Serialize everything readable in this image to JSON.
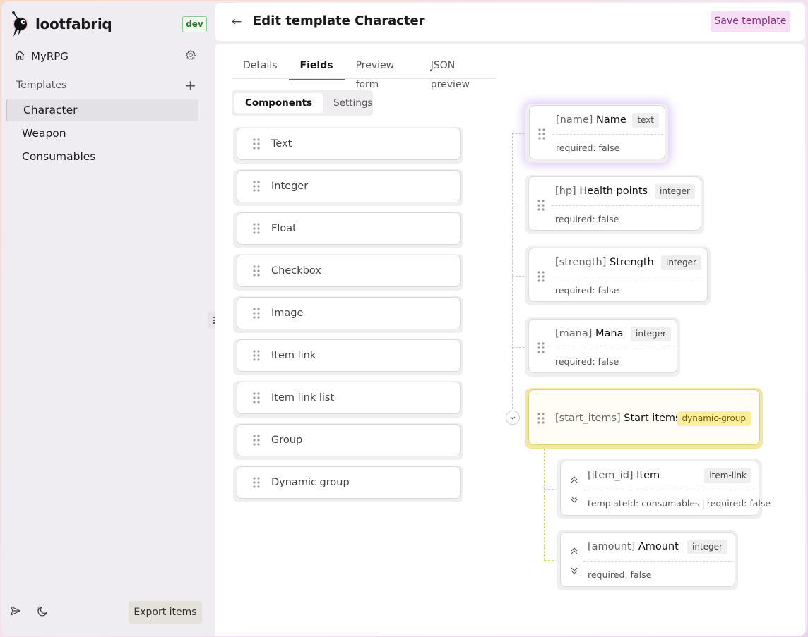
{
  "app": {
    "name": "lootfabriq",
    "env_badge": "dev",
    "project": "MyRPG"
  },
  "sidebar": {
    "section_label": "Templates",
    "items": [
      {
        "label": "Character",
        "active": true
      },
      {
        "label": "Weapon",
        "active": false
      },
      {
        "label": "Consumables",
        "active": false
      }
    ],
    "export_label": "Export items"
  },
  "header": {
    "title": "Edit template Character",
    "save_label": "Save template"
  },
  "tabs": [
    {
      "label": "Details",
      "active": false
    },
    {
      "label": "Fields",
      "active": true
    },
    {
      "label": "Preview form",
      "active": false
    },
    {
      "label": "JSON preview",
      "active": false
    }
  ],
  "subtabs": [
    {
      "label": "Components",
      "active": true
    },
    {
      "label": "Settings",
      "active": false
    }
  ],
  "components": [
    "Text",
    "Integer",
    "Float",
    "Checkbox",
    "Image",
    "Item link",
    "Item link list",
    "Group",
    "Dynamic group"
  ],
  "fields": [
    {
      "key": "[name]",
      "label": "Name",
      "type": "text",
      "meta": "required: false"
    },
    {
      "key": "[hp]",
      "label": "Health points",
      "type": "integer",
      "meta": "required: false"
    },
    {
      "key": "[strength]",
      "label": "Strength",
      "type": "integer",
      "meta": "required: false"
    },
    {
      "key": "[mana]",
      "label": "Mana",
      "type": "integer",
      "meta": "required: false"
    },
    {
      "key": "[start_items]",
      "label": "Start items",
      "type": "dynamic-group"
    }
  ],
  "children": [
    {
      "key": "[item_id]",
      "label": "Item",
      "type": "item-link",
      "meta1": "templateId: consumables",
      "meta2": "required: false"
    },
    {
      "key": "[amount]",
      "label": "Amount",
      "type": "integer",
      "meta": "required: false"
    }
  ],
  "colors": {
    "accent": "#8a2d80",
    "save_bg": "#f6def4",
    "group_border": "#e4d17b",
    "selected_glow": "#be96f0"
  }
}
